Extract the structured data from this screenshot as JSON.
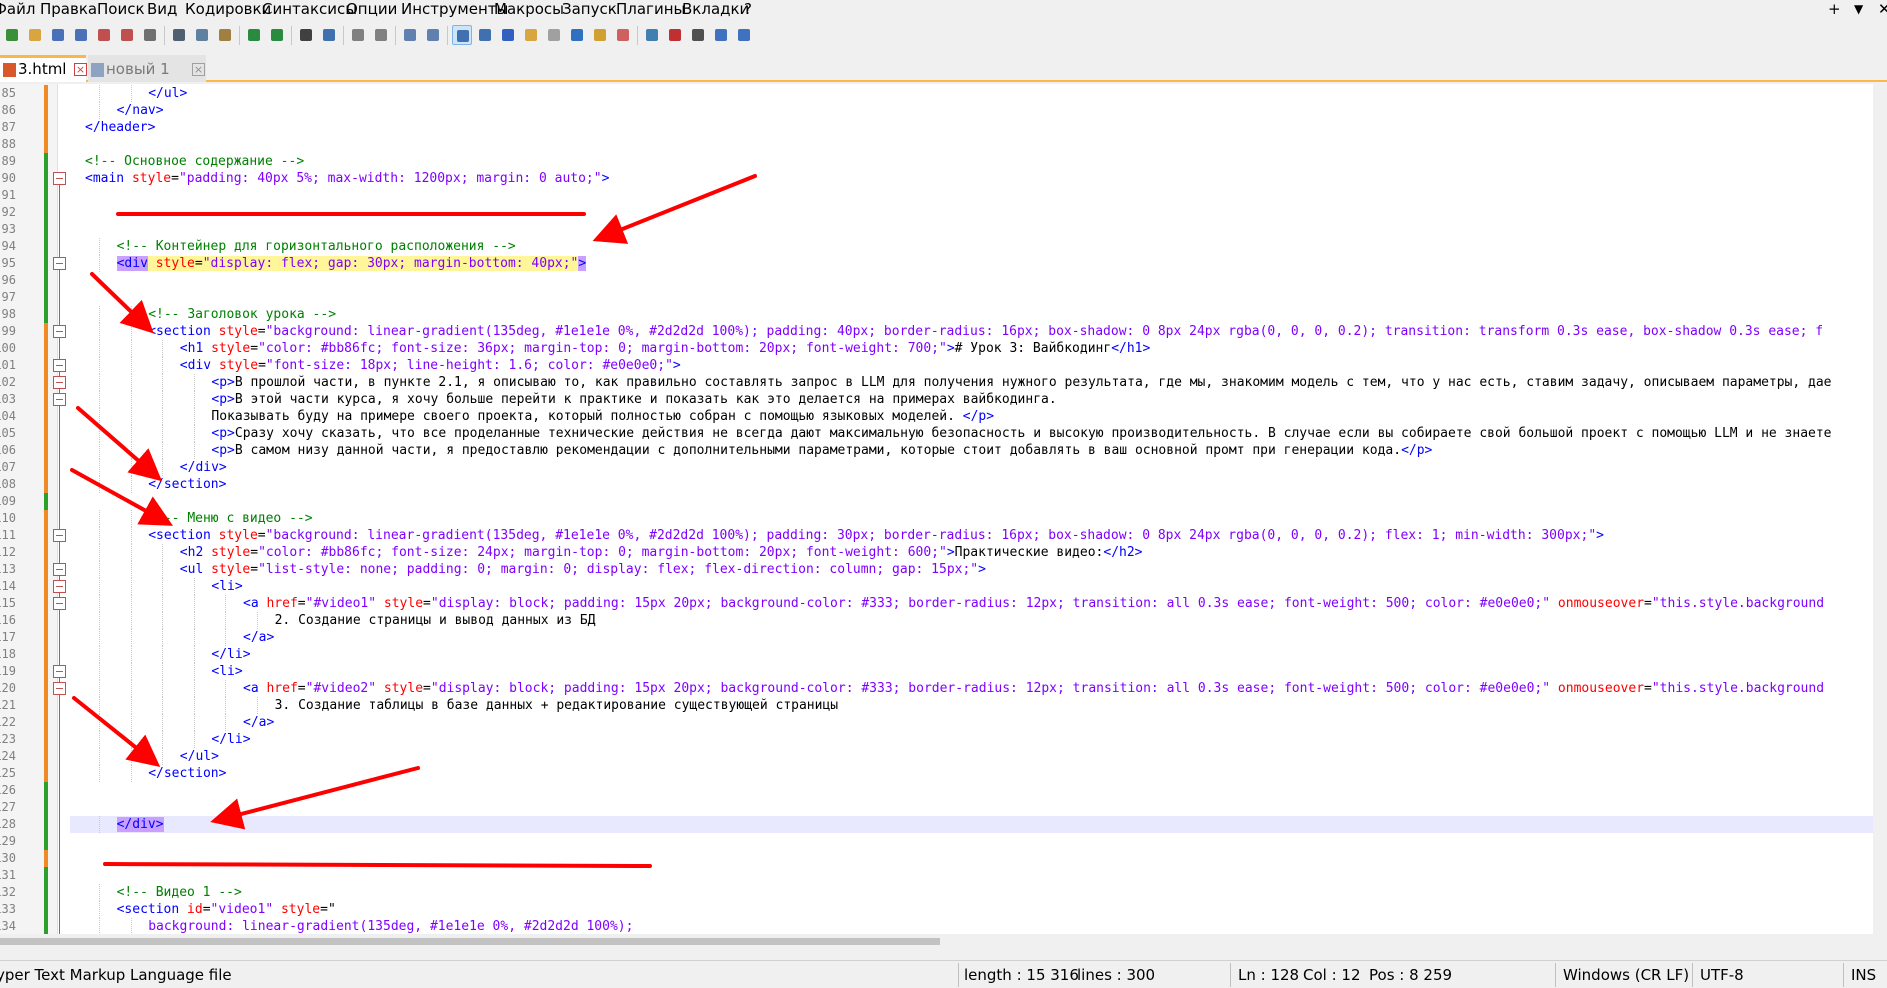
{
  "menu": [
    "Файл",
    "Правка",
    "Поиск",
    "Вид",
    "Кодировки",
    "Синтаксисы",
    "Опции",
    "Инструменты",
    "Макросы",
    "Запуск",
    "Плагины",
    "Вкладки",
    "?"
  ],
  "menu_controls": {
    "plus": "+",
    "dropdown": "▼",
    "close": "✕"
  },
  "tabs": [
    {
      "label": "3.html",
      "active": true
    },
    {
      "label": "новый 1",
      "active": false
    }
  ],
  "tab_close_glyph": "×",
  "toolbar_icons": [
    "new-file-icon",
    "open-file-icon",
    "save-icon",
    "save-all-icon",
    "close-icon",
    "close-all-icon",
    "print-icon",
    "cut-icon",
    "copy-icon",
    "paste-icon",
    "undo-icon",
    "redo-icon",
    "find-icon",
    "replace-icon",
    "zoom-in-icon",
    "zoom-out-icon",
    "sync-vertical-icon",
    "sync-horizontal-icon",
    "word-wrap-icon",
    "show-all-chars-icon",
    "indent-guide-icon",
    "user-lang-icon",
    "doc-map-icon",
    "function-list-icon",
    "folder-workspace-icon",
    "monitor-icon",
    "record-macro-icon",
    "stop-record-icon",
    "play-macro-icon",
    "run-macro-multiple-icon",
    "save-macro-icon"
  ],
  "editor": {
    "lines": [
      {
        "n": "85",
        "indent": 3,
        "segs": [
          [
            "t",
            "</ul>"
          ]
        ]
      },
      {
        "n": "86",
        "indent": 2,
        "segs": [
          [
            "t",
            "</nav>"
          ]
        ]
      },
      {
        "n": "87",
        "indent": 1,
        "segs": [
          [
            "t",
            "</header>"
          ]
        ]
      },
      {
        "n": "88",
        "indent": 0,
        "segs": []
      },
      {
        "n": "89",
        "indent": 1,
        "segs": [
          [
            "c",
            "<!-- Основное содержание -->"
          ]
        ]
      },
      {
        "n": "90",
        "indent": 1,
        "segs": [
          [
            "t",
            "<main "
          ],
          [
            "a",
            "style"
          ],
          [
            "x",
            "="
          ],
          [
            "v",
            "\"padding: 40px 5%; max-width: 1200px; margin: 0 auto;\""
          ],
          [
            "t",
            ">"
          ]
        ]
      },
      {
        "n": "91",
        "indent": 0,
        "segs": []
      },
      {
        "n": "92",
        "indent": 0,
        "segs": []
      },
      {
        "n": "93",
        "indent": 0,
        "segs": []
      },
      {
        "n": "94",
        "indent": 2,
        "segs": [
          [
            "c",
            "<!-- Контейнер для горизонтального расположения -->"
          ]
        ]
      },
      {
        "n": "95",
        "indent": 2,
        "segs": [
          [
            "t hl",
            "<div"
          ],
          [
            "x hy",
            " "
          ],
          [
            "a hy",
            "style"
          ],
          [
            "x hy",
            "="
          ],
          [
            "v hy",
            "\"display: flex; gap: 30px; margin-bottom: 40px;\""
          ],
          [
            "t hl",
            ">"
          ]
        ]
      },
      {
        "n": "96",
        "indent": 0,
        "segs": []
      },
      {
        "n": "97",
        "indent": 0,
        "segs": []
      },
      {
        "n": "98",
        "indent": 3,
        "segs": [
          [
            "c",
            "<!-- Заголовок урока -->"
          ]
        ]
      },
      {
        "n": "99",
        "indent": 3,
        "segs": [
          [
            "t",
            "<section "
          ],
          [
            "a",
            "style"
          ],
          [
            "x",
            "="
          ],
          [
            "v",
            "\"background: linear-gradient(135deg, #1e1e1e 0%, #2d2d2d 100%); padding: 40px; border-radius: 16px; box-shadow: 0 8px 24px rgba(0, 0, 0, 0.2); transition: transform 0.3s ease, box-shadow 0.3s ease; f"
          ]
        ]
      },
      {
        "n": "100",
        "indent": 4,
        "segs": [
          [
            "t",
            "<h1 "
          ],
          [
            "a",
            "style"
          ],
          [
            "x",
            "="
          ],
          [
            "v",
            "\"color: #bb86fc; font-size: 36px; margin-top: 0; margin-bottom: 20px; font-weight: 700;\""
          ],
          [
            "t",
            ">"
          ],
          [
            "x",
            "# Урок 3: Вайбкодинг"
          ],
          [
            "t",
            "</h1>"
          ]
        ]
      },
      {
        "n": "101",
        "indent": 4,
        "segs": [
          [
            "t",
            "<div "
          ],
          [
            "a",
            "style"
          ],
          [
            "x",
            "="
          ],
          [
            "v",
            "\"font-size: 18px; line-height: 1.6; color: #e0e0e0;\""
          ],
          [
            "t",
            ">"
          ]
        ]
      },
      {
        "n": "102",
        "indent": 5,
        "segs": [
          [
            "t",
            "<p>"
          ],
          [
            "x",
            "В прошлой части, в пункте 2.1, я описываю то, как правильно составлять запрос в LLM для получения нужного результата, где мы, знакомим модель с тем, что у нас есть, ставим задачу, описываем параметры, дае"
          ]
        ]
      },
      {
        "n": "103",
        "indent": 5,
        "segs": [
          [
            "t",
            "<p>"
          ],
          [
            "x",
            "В этой части курса, я хочу больше перейти к практике и показать как это делается на примерах вайбкодинга."
          ]
        ]
      },
      {
        "n": "104",
        "indent": 5,
        "segs": [
          [
            "x",
            "Показывать буду на примере своего проекта, который полностью собран с помощью языковых моделей. "
          ],
          [
            "t",
            "</p>"
          ]
        ]
      },
      {
        "n": "105",
        "indent": 5,
        "segs": [
          [
            "t",
            "<p>"
          ],
          [
            "x",
            "Сразу хочу сказать, что все проделанные технические действия не всегда дают максимальную безопасность и высокую производительность. В случае если вы собираете свой большой проект с помощью LLM и не знаете"
          ]
        ]
      },
      {
        "n": "106",
        "indent": 5,
        "segs": [
          [
            "t",
            "<p>"
          ],
          [
            "x",
            "В самом низу данной части, я предоставлю рекомендации с дополнительными параметрами, которые стоит добавлять в ваш основной промт при генерации кода."
          ],
          [
            "t",
            "</p>"
          ]
        ]
      },
      {
        "n": "107",
        "indent": 4,
        "segs": [
          [
            "t",
            "</div>"
          ]
        ]
      },
      {
        "n": "108",
        "indent": 3,
        "segs": [
          [
            "t",
            "</section>"
          ]
        ]
      },
      {
        "n": "109",
        "indent": 0,
        "segs": []
      },
      {
        "n": "110",
        "indent": 3,
        "segs": [
          [
            "c",
            "<!-- Меню с видео -->"
          ]
        ]
      },
      {
        "n": "111",
        "indent": 3,
        "segs": [
          [
            "t",
            "<section "
          ],
          [
            "a",
            "style"
          ],
          [
            "x",
            "="
          ],
          [
            "v",
            "\"background: linear-gradient(135deg, #1e1e1e 0%, #2d2d2d 100%); padding: 30px; border-radius: 16px; box-shadow: 0 8px 24px rgba(0, 0, 0, 0.2); flex: 1; min-width: 300px;\""
          ],
          [
            "t",
            ">"
          ]
        ]
      },
      {
        "n": "112",
        "indent": 4,
        "segs": [
          [
            "t",
            "<h2 "
          ],
          [
            "a",
            "style"
          ],
          [
            "x",
            "="
          ],
          [
            "v",
            "\"color: #bb86fc; font-size: 24px; margin-top: 0; margin-bottom: 20px; font-weight: 600;\""
          ],
          [
            "t",
            ">"
          ],
          [
            "x",
            "Практические видео:"
          ],
          [
            "t",
            "</h2>"
          ]
        ]
      },
      {
        "n": "113",
        "indent": 4,
        "segs": [
          [
            "t",
            "<ul "
          ],
          [
            "a",
            "style"
          ],
          [
            "x",
            "="
          ],
          [
            "v",
            "\"list-style: none; padding: 0; margin: 0; display: flex; flex-direction: column; gap: 15px;\""
          ],
          [
            "t",
            ">"
          ]
        ]
      },
      {
        "n": "114",
        "indent": 5,
        "segs": [
          [
            "t",
            "<li>"
          ]
        ]
      },
      {
        "n": "115",
        "indent": 6,
        "segs": [
          [
            "t",
            "<a "
          ],
          [
            "a",
            "href"
          ],
          [
            "x",
            "="
          ],
          [
            "v",
            "\"#video1\""
          ],
          [
            "x",
            " "
          ],
          [
            "a",
            "style"
          ],
          [
            "x",
            "="
          ],
          [
            "v",
            "\"display: block; padding: 15px 20px; background-color: #333; border-radius: 12px; transition: all 0.3s ease; font-weight: 500; color: #e0e0e0;\""
          ],
          [
            "x",
            " "
          ],
          [
            "a",
            "onmouseover"
          ],
          [
            "x",
            "="
          ],
          [
            "v",
            "\"this.style.background"
          ]
        ]
      },
      {
        "n": "116",
        "indent": 7,
        "segs": [
          [
            "x",
            "2. Создание страницы и вывод данных из БД"
          ]
        ]
      },
      {
        "n": "117",
        "indent": 6,
        "segs": [
          [
            "t",
            "</a>"
          ]
        ]
      },
      {
        "n": "118",
        "indent": 5,
        "segs": [
          [
            "t",
            "</li>"
          ]
        ]
      },
      {
        "n": "119",
        "indent": 5,
        "segs": [
          [
            "t",
            "<li>"
          ]
        ]
      },
      {
        "n": "120",
        "indent": 6,
        "segs": [
          [
            "t",
            "<a "
          ],
          [
            "a",
            "href"
          ],
          [
            "x",
            "="
          ],
          [
            "v",
            "\"#video2\""
          ],
          [
            "x",
            " "
          ],
          [
            "a",
            "style"
          ],
          [
            "x",
            "="
          ],
          [
            "v",
            "\"display: block; padding: 15px 20px; background-color: #333; border-radius: 12px; transition: all 0.3s ease; font-weight: 500; color: #e0e0e0;\""
          ],
          [
            "x",
            " "
          ],
          [
            "a",
            "onmouseover"
          ],
          [
            "x",
            "="
          ],
          [
            "v",
            "\"this.style.background"
          ]
        ]
      },
      {
        "n": "121",
        "indent": 7,
        "segs": [
          [
            "x",
            "3. Создание таблицы в базе данных + редактирование существующей страницы"
          ]
        ]
      },
      {
        "n": "122",
        "indent": 6,
        "segs": [
          [
            "t",
            "</a>"
          ]
        ]
      },
      {
        "n": "123",
        "indent": 5,
        "segs": [
          [
            "t",
            "</li>"
          ]
        ]
      },
      {
        "n": "124",
        "indent": 4,
        "segs": [
          [
            "t",
            "</ul>"
          ]
        ]
      },
      {
        "n": "125",
        "indent": 3,
        "segs": [
          [
            "t",
            "</section>"
          ]
        ]
      },
      {
        "n": "126",
        "indent": 0,
        "segs": []
      },
      {
        "n": "127",
        "indent": 0,
        "segs": []
      },
      {
        "n": "128",
        "indent": 2,
        "segs": [
          [
            "t hl",
            "</div>"
          ]
        ]
      },
      {
        "n": "129",
        "indent": 0,
        "segs": []
      },
      {
        "n": "130",
        "indent": 0,
        "segs": []
      },
      {
        "n": "131",
        "indent": 0,
        "segs": []
      },
      {
        "n": "132",
        "indent": 2,
        "segs": [
          [
            "c",
            "<!-- Видео 1 -->"
          ]
        ]
      },
      {
        "n": "133",
        "indent": 2,
        "segs": [
          [
            "t",
            "<section "
          ],
          [
            "a",
            "id"
          ],
          [
            "x",
            "="
          ],
          [
            "v",
            "\"video1\""
          ],
          [
            "x",
            " "
          ],
          [
            "a",
            "style"
          ],
          [
            "x",
            "=\""
          ]
        ]
      },
      {
        "n": "134",
        "indent": 3,
        "segs": [
          [
            "v",
            "background: linear-gradient(135deg, #1e1e1e 0%, #2d2d2d 100%);"
          ]
        ]
      }
    ],
    "fold_lines": [
      "90",
      "95",
      "99",
      "101",
      "102",
      "103",
      "111",
      "113",
      "114",
      "115",
      "119",
      "120"
    ],
    "current_line": "128",
    "change_markers": [
      [
        "85",
        "orange"
      ],
      [
        "89",
        "green"
      ],
      [
        "99",
        "orange"
      ],
      [
        "109",
        "green"
      ],
      [
        "110",
        "orange"
      ],
      [
        "126",
        "green"
      ],
      [
        "130",
        "orange"
      ],
      [
        "131",
        "green"
      ]
    ]
  },
  "status": {
    "file_type": "yper Text Markup Language file",
    "length": "length : 15 316",
    "lines": "lines : 300",
    "ln": "Ln : 128",
    "col": "Col : 12",
    "pos": "Pos : 8 259",
    "eol": "Windows (CR LF)",
    "encoding": "UTF-8",
    "mode": "INS"
  },
  "colors": {
    "annotation": "#ff0000",
    "accent": "#fcb847",
    "tag": "#0000ff",
    "attr": "#ff0000",
    "value": "#8000ff",
    "comment": "#008000"
  }
}
